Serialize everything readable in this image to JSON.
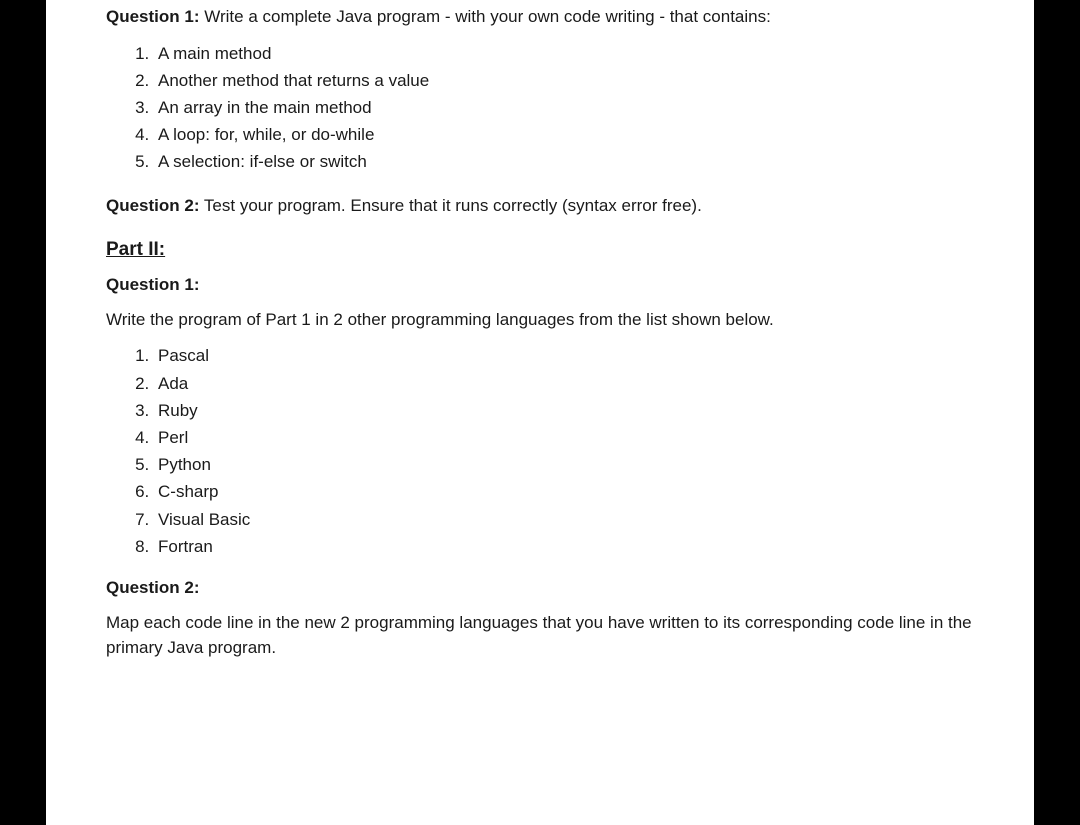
{
  "p1_q1": {
    "label": "Question 1:",
    "text": " Write a complete Java program - with your own code writing - that contains:",
    "items": [
      "A main method",
      "Another method that returns a value",
      "An array in the main method",
      "A loop: for, while, or do-while",
      "A selection: if-else or switch"
    ]
  },
  "p1_q2": {
    "label": "Question 2:",
    "text": " Test your program. Ensure that it runs correctly (syntax error free)."
  },
  "part2_header": "Part II:",
  "p2_q1": {
    "label": "Question 1:",
    "text": "Write the program of Part 1 in 2 other programming languages from the list shown below.",
    "items": [
      "Pascal",
      "Ada",
      "Ruby",
      "Perl",
      "Python",
      "C-sharp",
      "Visual Basic",
      "Fortran"
    ]
  },
  "p2_q2": {
    "label": "Question 2:",
    "text": "Map each code line in the new 2 programming languages that you have written to its corresponding code line in the primary Java program."
  }
}
